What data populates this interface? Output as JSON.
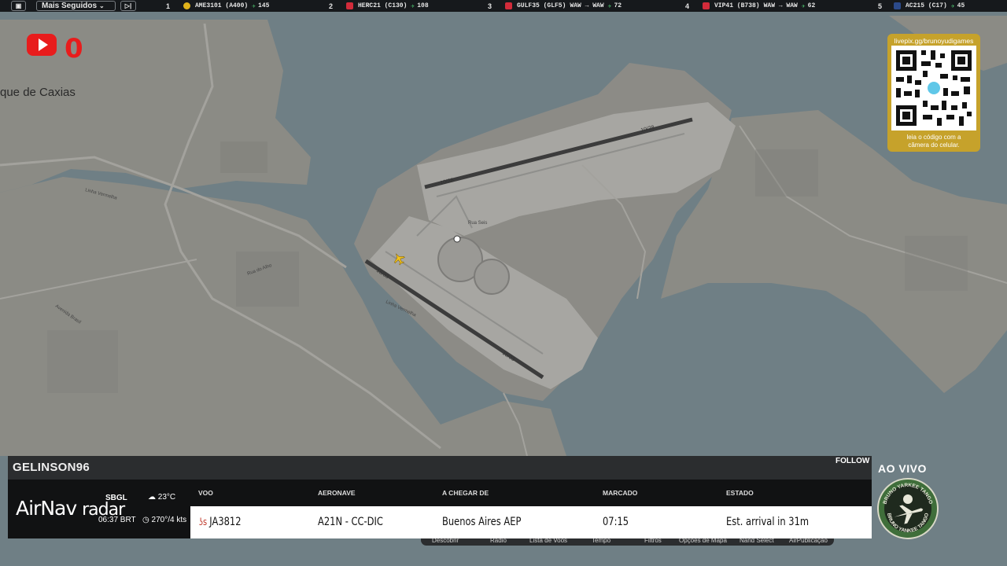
{
  "topbar": {
    "filter_label": "Mais Seguidos",
    "flights": [
      {
        "rank": "1",
        "callsign": "AME3101 (A400)",
        "followers": "145",
        "route": ""
      },
      {
        "rank": "2",
        "callsign": "HERC21 (C130)",
        "followers": "108",
        "route": ""
      },
      {
        "rank": "3",
        "callsign": "GULF35 (GLF5)",
        "followers": "72",
        "route": "WAW → WAW"
      },
      {
        "rank": "4",
        "callsign": "VIP41 (B738)",
        "followers": "62",
        "route": "WAW → WAW"
      },
      {
        "rank": "5",
        "callsign": "AC215 (C17)",
        "followers": "45",
        "route": ""
      }
    ]
  },
  "youtube": {
    "count": "0"
  },
  "map": {
    "place_label": "que de Caxias",
    "runway_labels": [
      "10/28",
      "10/28",
      "15/33",
      "15/33"
    ],
    "street_labels": [
      "Linha Vermelha",
      "Linha Vermelha",
      "Rua Seis",
      "Avenida Brasil",
      "Rua do Alho"
    ]
  },
  "qr": {
    "url": "livepix.gg/brunoyudigames",
    "caption_line1": "leia o código com a",
    "caption_line2": "câmera do celular."
  },
  "panel": {
    "user": "GELINSON96",
    "follow_label": "FOLLOW",
    "brand_main": "AirNav",
    "brand_sub": "radar",
    "airport": "SBGL",
    "time": "06:37 BRT",
    "temperature": "23°C",
    "wind": "270°/4 kts",
    "headers": {
      "voo": "VOO",
      "aeronave": "AERONAVE",
      "origin": "A CHEGAR DE",
      "scheduled": "MARCADO",
      "status": "ESTADO"
    },
    "row": {
      "flight": "JA3812",
      "aircraft": "A21N - CC-DIC",
      "origin": "Buenos Aires AEP",
      "scheduled": "07:15",
      "status": "Est. arrival in 31m"
    },
    "behind_tabs": [
      "Descobrir",
      "Rádio",
      "Lista de Voos",
      "Tempo",
      "Filtros",
      "Opções de Mapa",
      "Nand Select",
      "AirPublicação"
    ]
  },
  "live_label": "AO VIVO",
  "logo_text": {
    "top": "BRUNO YARKEE TANGO",
    "bottom": "BRUNO YANKEE TANGO"
  },
  "colors": {
    "water": "#6f7f85",
    "land": "#8c8c86",
    "airport": "#a6a6a3",
    "accent_green": "#4cc06d",
    "youtube_red": "#e81c1c",
    "qr_gold": "#c6a22b"
  }
}
